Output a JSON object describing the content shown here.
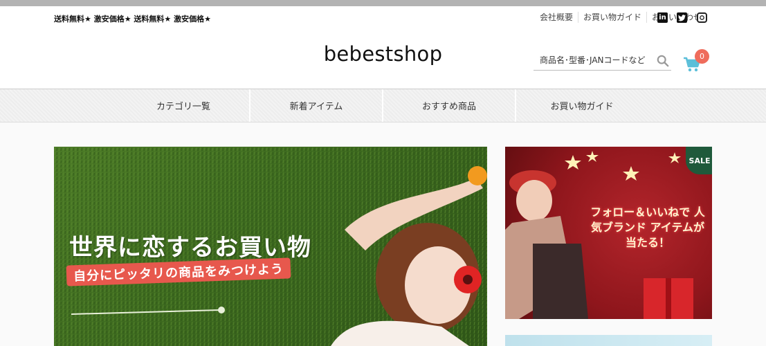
{
  "header": {
    "promo": "送料無料★ 激安価格★ 送料無料★ 激安価格★",
    "utility_links": [
      "会社概要",
      "お買い物ガイド",
      "お問い合わせ"
    ],
    "social": [
      "linkedin-icon",
      "twitter-icon",
      "instagram-icon"
    ],
    "social_labels": {
      "linkedin": "in",
      "twitter": "t",
      "instagram": "◎"
    },
    "logo": "bebestshop",
    "search_placeholder": "商品名･型番･JANコードなど",
    "cart_count": "0"
  },
  "nav": {
    "items": [
      "カテゴリ一覧",
      "新着アイテム",
      "おすすめ商品",
      "お買い物ガイド"
    ]
  },
  "hero": {
    "title": "世界に恋するお買い物",
    "subtitle": "自分にピッタリの商品をみつけよう"
  },
  "side_banner": {
    "text": "フォロー＆いいねで 人気ブランド アイテムが当たる！",
    "badge": "SALE"
  },
  "colors": {
    "badge": "#ef6c5c",
    "cart": "#5bbfd9",
    "hero_bg": "#3d6a1f",
    "side_bg": "#8f161c",
    "subtitle_bg": "#e7584d"
  }
}
